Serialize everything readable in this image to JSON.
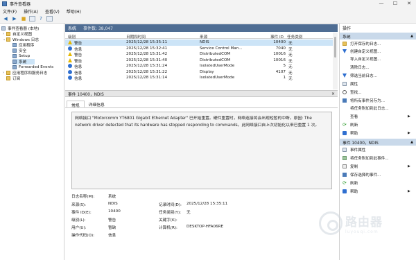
{
  "window": {
    "title": "事件查看器"
  },
  "menu": [
    "文件(F)",
    "操作(A)",
    "查看(V)",
    "帮助(H)"
  ],
  "tree": {
    "root": "事件查看器 (本地)",
    "custom_views": "自定义视图",
    "windows_logs": "Windows 日志",
    "application": "应用程序",
    "security": "安全",
    "setup": "Setup",
    "system": "系统",
    "forwarded": "Forwarded Events",
    "apps_services": "应用程序和服务日志",
    "subscriptions": "订阅"
  },
  "center": {
    "title": "系统",
    "subtitle": "事件数: 38,047",
    "columns": {
      "level": "级别",
      "datetime": "日期和时间",
      "source": "来源",
      "event_id": "事件 ID",
      "category": "任务类别"
    },
    "rows": [
      {
        "level": "警告",
        "type": "warning",
        "datetime": "2025/12/28 15:35:11",
        "source": "NDIS",
        "event_id": "10400",
        "category": "无"
      },
      {
        "level": "信息",
        "type": "info",
        "datetime": "2025/12/28 15:32:41",
        "source": "Service Control Man...",
        "event_id": "7040",
        "category": "无"
      },
      {
        "level": "警告",
        "type": "warning",
        "datetime": "2025/12/28 15:31:42",
        "source": "DistributedCOM",
        "event_id": "10016",
        "category": "无"
      },
      {
        "level": "警告",
        "type": "warning",
        "datetime": "2025/12/28 15:31:40",
        "source": "DistributedCOM",
        "event_id": "10016",
        "category": "无"
      },
      {
        "level": "信息",
        "type": "info",
        "datetime": "2025/12/28 15:31:24",
        "source": "IsolatedUserMode",
        "event_id": "5",
        "category": "无"
      },
      {
        "level": "信息",
        "type": "info",
        "datetime": "2025/12/28 15:31:22",
        "source": "Display",
        "event_id": "4107",
        "category": "无"
      },
      {
        "level": "信息",
        "type": "info",
        "datetime": "2025/12/28 15:31:14",
        "source": "IsolatedUserMode",
        "event_id": "1",
        "category": "无"
      }
    ]
  },
  "detail": {
    "header": "事件 10400，NDIS",
    "close": "×",
    "tabs": [
      "常规",
      "详细信息"
    ],
    "description": "网络接口 \"Motorcomm YT6801 Gigabit Ethernet Adapter\" 已开始重置。硬件重置时，网络连接将会出现短暂的中断。原因: The network driver detected that its hardware has stopped responding to commands。此网络接口自上次初始化以来已重置 1 次。",
    "props": {
      "log_name_label": "日志名称(M):",
      "log_name": "系统",
      "source_label": "来源(S):",
      "source": "NDIS",
      "logged_label": "记录时间(D):",
      "logged": "2025/12/28 15:35:11",
      "event_id_label": "事件 ID(E):",
      "event_id": "10400",
      "task_label": "任务类别(Y):",
      "task": "无",
      "level_label": "级别(L):",
      "level": "警告",
      "keywords_label": "关键字(K):",
      "keywords": "",
      "user_label": "用户(U):",
      "user": "暂缺",
      "computer_label": "计算机(R):",
      "computer": "DESKTOP-HFA06RE",
      "opcode_label": "操作代码(O):",
      "opcode": "信息"
    }
  },
  "actions": {
    "title": "操作",
    "section1": "系统",
    "items1": [
      "打开保存的日志...",
      "创建自定义视图...",
      "导入自定义视图...",
      "清除日志...",
      "筛选当前日志...",
      "属性",
      "查找...",
      "将所有事件另存为...",
      "将任务附加到此日志...",
      "查看",
      "刷新",
      "帮助"
    ],
    "section2": "事件 10400，NDIS",
    "items2": [
      "事件属性",
      "将任务附加到此事件...",
      "复制",
      "保存选择的事件...",
      "刷新",
      "帮助"
    ]
  },
  "watermark": {
    "cn": "路由器",
    "en": "luyouqi.com"
  }
}
